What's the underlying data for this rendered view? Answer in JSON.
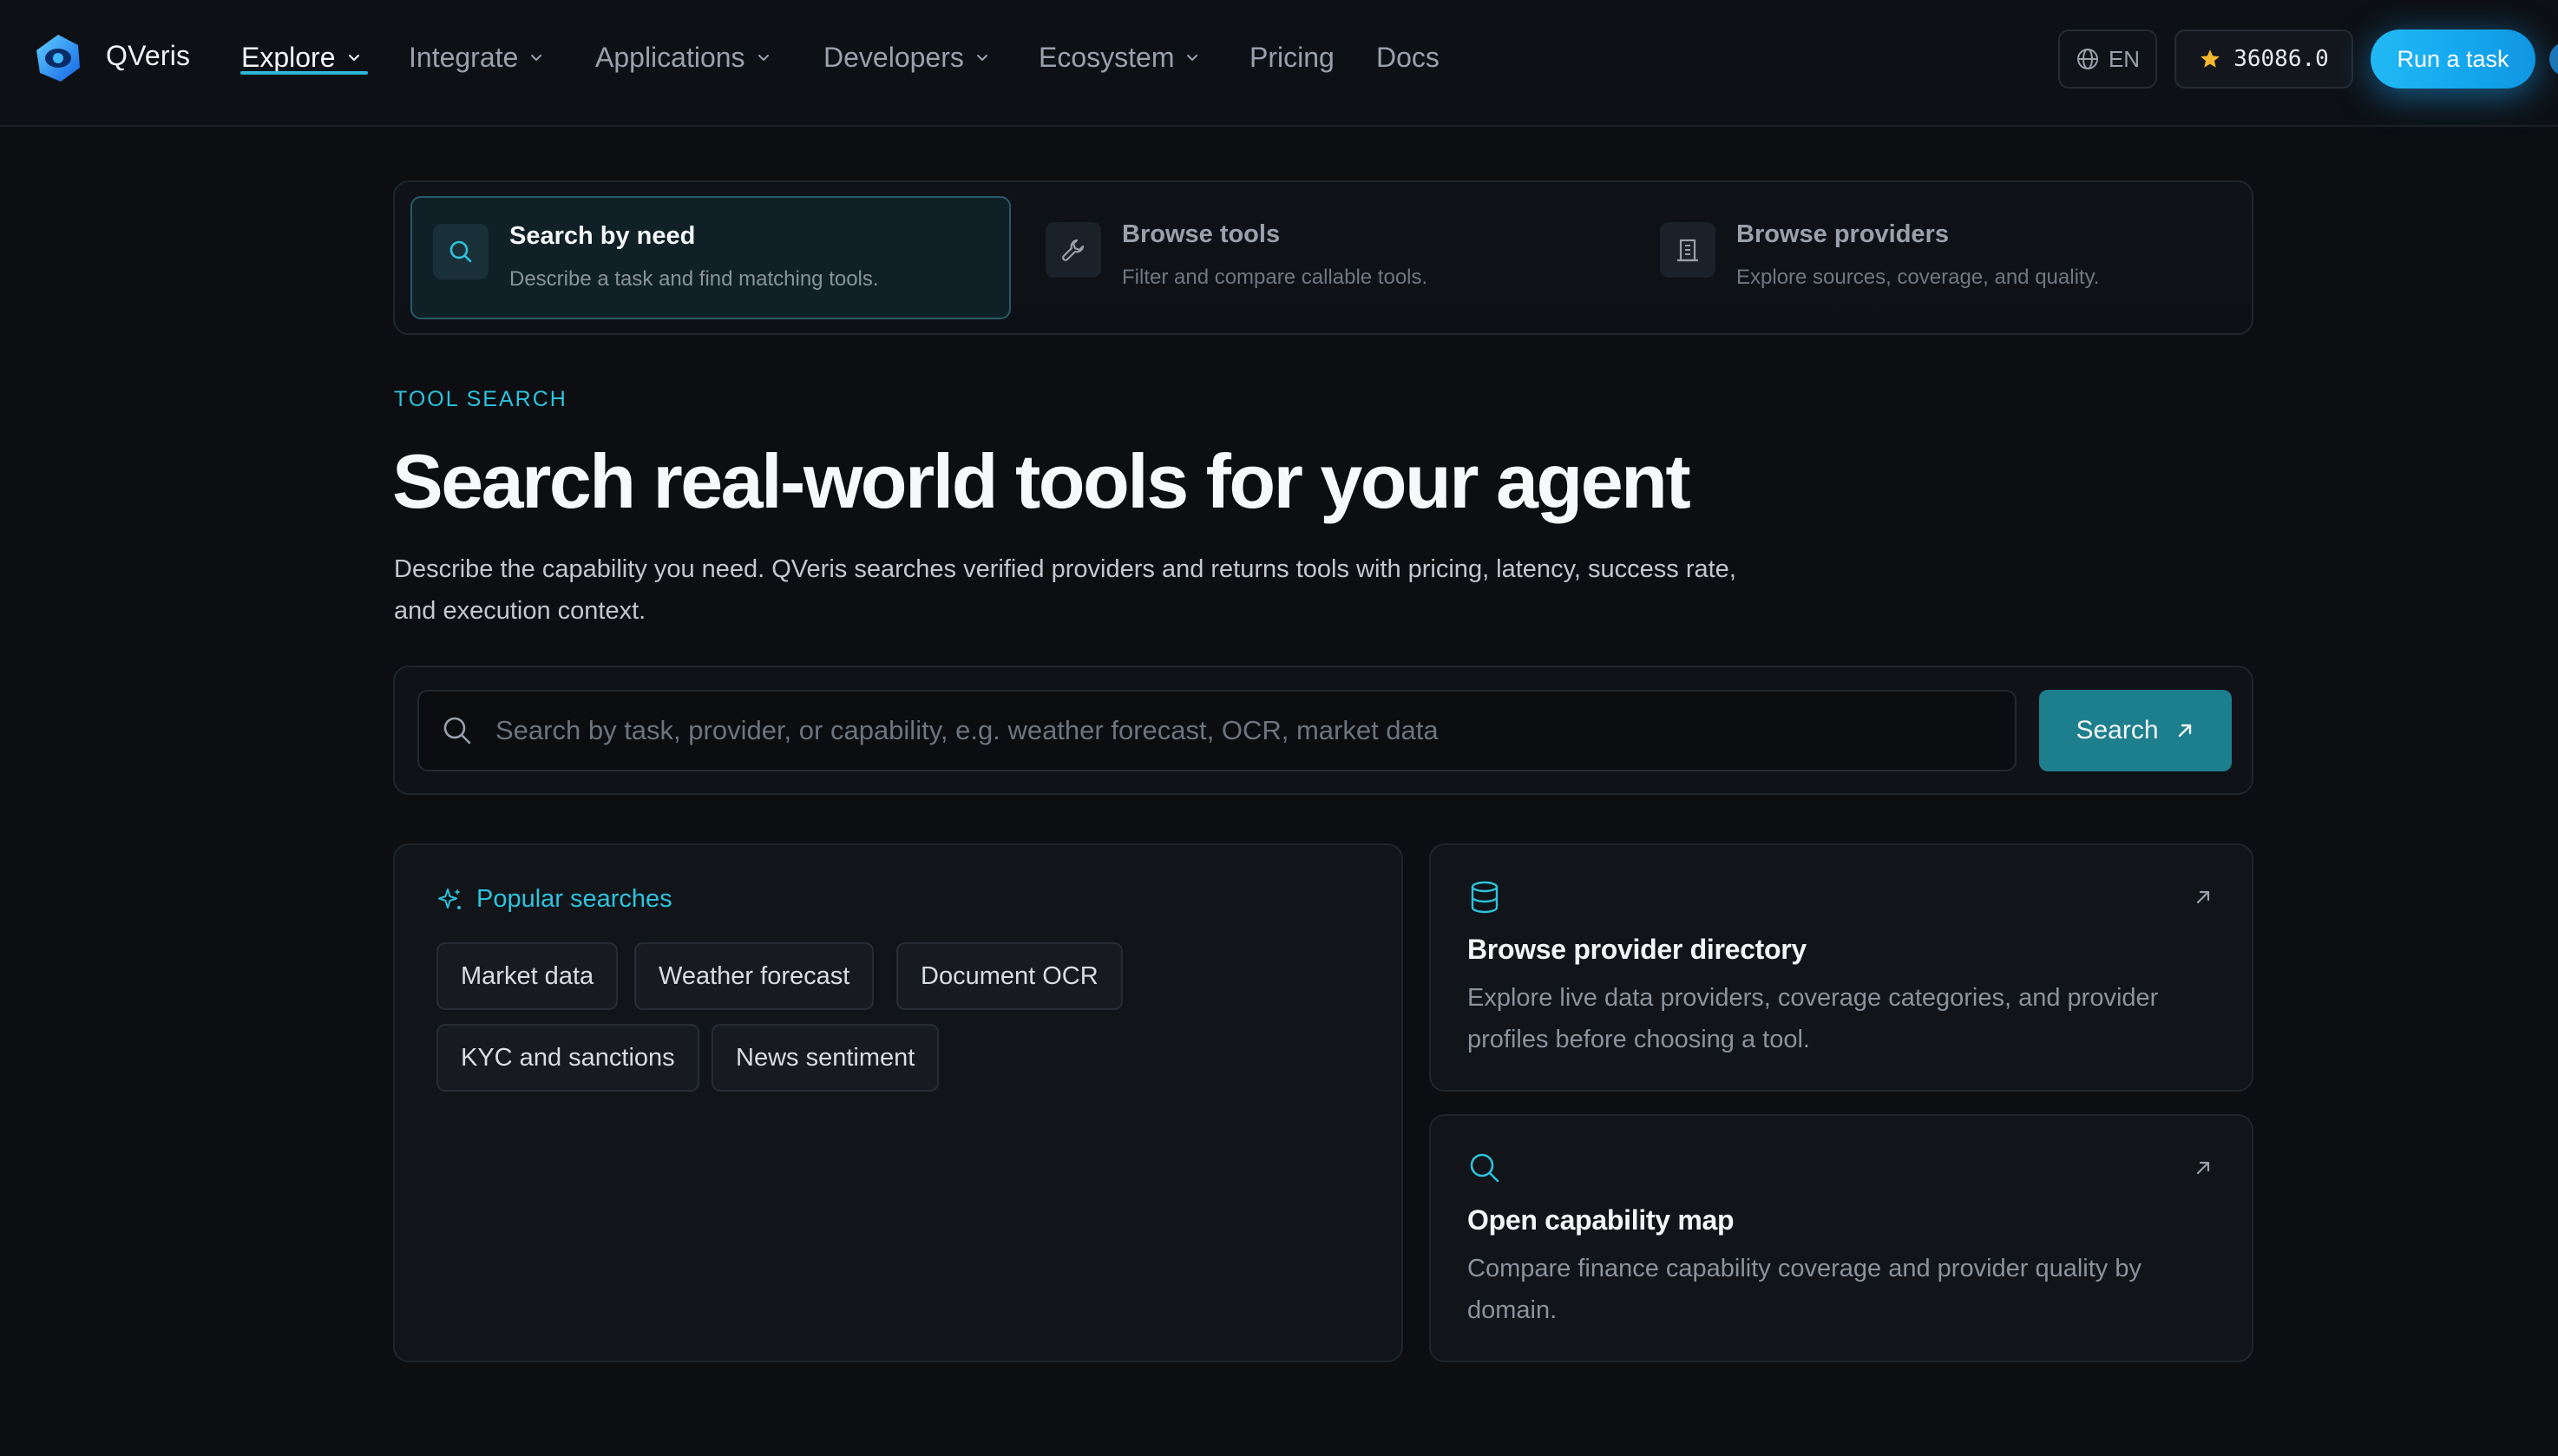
{
  "nav": {
    "brand": "QVeris",
    "items": [
      {
        "label": "Explore",
        "has_dropdown": true,
        "active": true
      },
      {
        "label": "Integrate",
        "has_dropdown": true
      },
      {
        "label": "Applications",
        "has_dropdown": true
      },
      {
        "label": "Developers",
        "has_dropdown": true
      },
      {
        "label": "Ecosystem",
        "has_dropdown": true
      },
      {
        "label": "Pricing",
        "has_dropdown": false
      },
      {
        "label": "Docs",
        "has_dropdown": false
      }
    ],
    "language": "EN",
    "star_count": "36086.0",
    "cta": "Run a task"
  },
  "tabs": [
    {
      "title": "Search by need",
      "desc": "Describe a task and find matching tools.",
      "icon": "search-icon",
      "active": true
    },
    {
      "title": "Browse tools",
      "desc": "Filter and compare callable tools.",
      "icon": "wrench-icon",
      "active": false
    },
    {
      "title": "Browse providers",
      "desc": "Explore sources, coverage, and quality.",
      "icon": "building-icon",
      "active": false
    }
  ],
  "hero": {
    "eyebrow": "TOOL SEARCH",
    "title": "Search real-world tools for your agent",
    "description": "Describe the capability you need. QVeris searches verified providers and returns tools with pricing, latency, success rate, and execution context."
  },
  "search": {
    "placeholder": "Search by task, provider, or capability, e.g. weather forecast, OCR, market data",
    "value": "",
    "button": "Search"
  },
  "popular": {
    "heading": "Popular searches",
    "chips": [
      "Market data",
      "Weather forecast",
      "Document OCR",
      "KYC and sanctions",
      "News sentiment"
    ]
  },
  "cards": [
    {
      "title": "Browse provider directory",
      "desc": "Explore live data providers, coverage categories, and provider profiles before choosing a tool.",
      "icon": "database-icon"
    },
    {
      "title": "Open capability map",
      "desc": "Compare finance capability coverage and provider quality by domain.",
      "icon": "search-icon"
    }
  ],
  "colors": {
    "background": "#0c0e12",
    "accent": "#2dc3dc",
    "cta": "#14a6ee",
    "search_button": "#1d7f8e"
  }
}
